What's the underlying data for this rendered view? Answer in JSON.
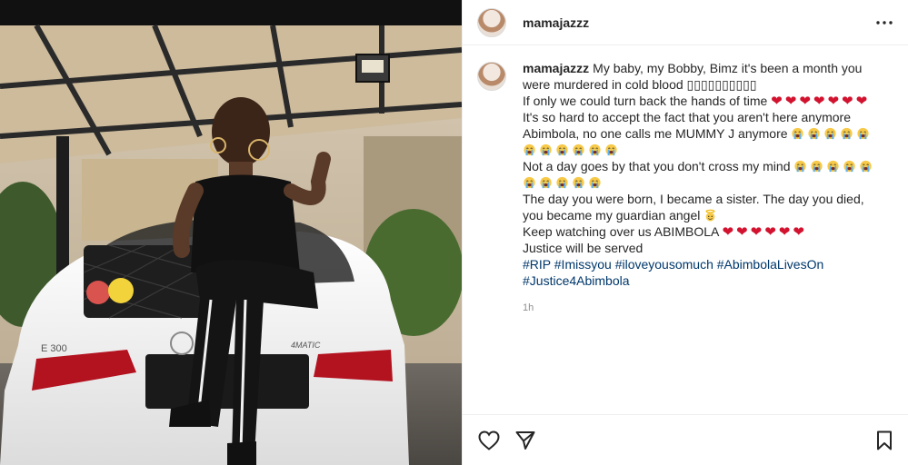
{
  "post": {
    "username": "mamajazzz",
    "more_icon": "more-horizontal-icon",
    "caption": {
      "username": "mamajazzz",
      "line1": "My baby, my Bobby, Bimz it's been a month you were murdered in cold blood ▯▯▯▯▯▯▯▯▯▯",
      "line2": "If only we could turn back the hands of time",
      "line2_hearts": 7,
      "line3": "It's so hard to accept the fact that you aren't here anymore Abimbola, no one calls me MUMMY J anymore",
      "line3_emojis": 11,
      "line4": "Not a day goes by that you don't cross my mind",
      "line4_emojis": 10,
      "line5": "The day you were born, I became a sister. The day you died, you became my guardian angel",
      "line5_emoji": "angel-emoji",
      "line6": "Keep watching over us ABIMBOLA",
      "line6_hearts": 6,
      "line7": "Justice will be served",
      "hashtags": [
        "#RIP",
        "#Imissyou",
        "#iloveyousomuch",
        "#AbimbolaLivesOn",
        "#Justice4Abimbola"
      ]
    },
    "time": "1h",
    "actions": {
      "like_icon": "heart-outline-icon",
      "share_icon": "paper-plane-icon",
      "save_icon": "bookmark-icon"
    },
    "photo": {
      "plate": "E 300",
      "badge": "4MATIC"
    },
    "colors": {
      "heart": "#d2122e",
      "hashtag": "#00376b",
      "muted": "#8e8e8e"
    }
  }
}
